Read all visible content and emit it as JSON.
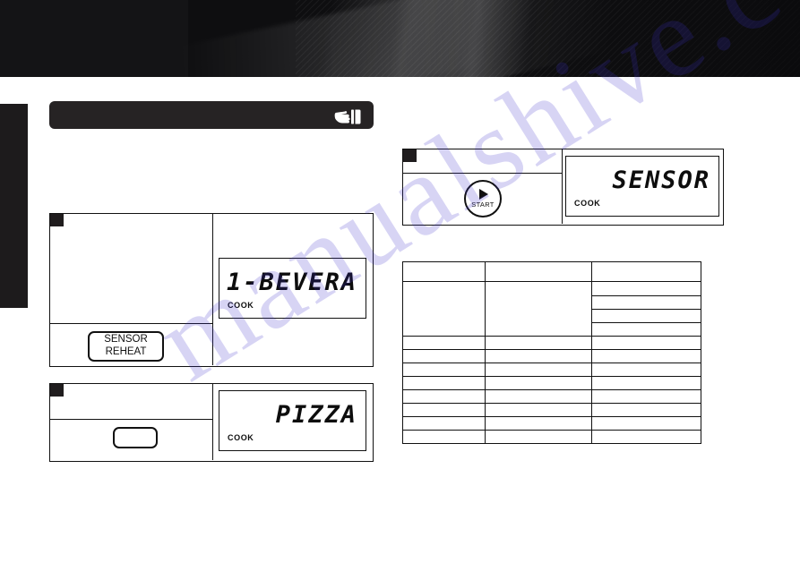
{
  "page": {
    "background_color": "#ffffff",
    "banner_color": "#0e0e10",
    "ink_color": "#111111",
    "watermark_text": "manualshive.com",
    "watermark_color": "#3b2fc9"
  },
  "section_header": {
    "title": "",
    "icon": "pointing-hand-icon"
  },
  "steps": [
    {
      "marker": "",
      "button": {
        "line1": "SENSOR",
        "line2": "REHEAT"
      },
      "display": {
        "value": "1-BEVERA",
        "sub_label": "COOK"
      }
    },
    {
      "marker": "",
      "button": {
        "line1": "",
        "line2": ""
      },
      "display": {
        "value": "PIZZA",
        "sub_label": "COOK"
      }
    },
    {
      "marker": "",
      "button": {
        "line1": "START",
        "line2": "",
        "icon": "play-triangle-icon"
      },
      "display": {
        "value": "SENSOR",
        "sub_label": "COOK"
      }
    }
  ],
  "table": {
    "columns": [
      "",
      "",
      ""
    ],
    "rows": [
      {
        "cells": [
          "",
          "",
          ""
        ]
      },
      {
        "cells": [
          "",
          "",
          ""
        ]
      },
      {
        "cells": [
          "",
          "",
          ""
        ]
      },
      {
        "cells": [
          "",
          "",
          ""
        ]
      },
      {
        "cells": [
          "",
          "",
          ""
        ]
      },
      {
        "cells": [
          "",
          "",
          ""
        ]
      },
      {
        "cells": [
          "",
          "",
          ""
        ]
      },
      {
        "cells": [
          "",
          "",
          ""
        ]
      },
      {
        "cells": [
          "",
          "",
          ""
        ]
      },
      {
        "cells": [
          "",
          "",
          ""
        ]
      },
      {
        "cells": [
          "",
          "",
          ""
        ]
      },
      {
        "cells": [
          "",
          "",
          ""
        ]
      },
      {
        "cells": [
          "",
          "",
          ""
        ]
      }
    ]
  }
}
